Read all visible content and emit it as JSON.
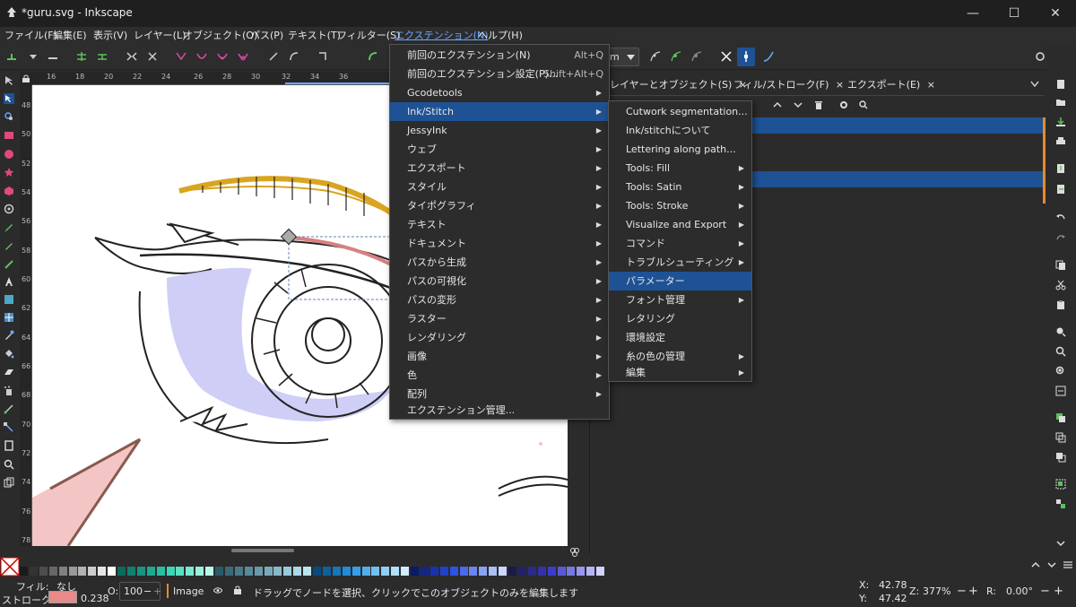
{
  "window": {
    "title": "*guru.svg - Inkscape",
    "controls": [
      "—",
      "☐",
      "✕"
    ]
  },
  "menubar": {
    "items": [
      "ファイル(F)",
      "編集(E)",
      "表示(V)",
      "レイヤー(L)",
      "オブジェクト(O)",
      "パス(P)",
      "テキスト(T)",
      "フィルター(S)",
      "エクステンション(N)",
      "ヘルプ(H)"
    ],
    "active_index": 8
  },
  "toolbar": {
    "units_label": "m"
  },
  "rulers": {
    "h_ticks": [
      "16",
      "18",
      "20",
      "22",
      "24",
      "26",
      "28",
      "30",
      "32",
      "34",
      "36"
    ],
    "v_ticks": [
      "48",
      "50",
      "52",
      "54",
      "56",
      "58",
      "60",
      "62",
      "64",
      "66",
      "68",
      "70",
      "72",
      "74",
      "76",
      "78"
    ]
  },
  "extensions_menu": {
    "items": [
      {
        "label": "前回のエクステンション(N)",
        "accel": "Alt+Q",
        "submenu": false
      },
      {
        "label": "前回のエクステンション設定(P)...",
        "accel": "Shift+Alt+Q",
        "submenu": false
      },
      {
        "label": "Gcodetools",
        "accel": "",
        "submenu": true
      },
      {
        "label": "Ink/Stitch",
        "accel": "",
        "submenu": true
      },
      {
        "label": "JessyInk",
        "accel": "",
        "submenu": true
      },
      {
        "label": "ウェブ",
        "accel": "",
        "submenu": true
      },
      {
        "label": "エクスポート",
        "accel": "",
        "submenu": true
      },
      {
        "label": "スタイル",
        "accel": "",
        "submenu": true
      },
      {
        "label": "タイポグラフィ",
        "accel": "",
        "submenu": true
      },
      {
        "label": "テキスト",
        "accel": "",
        "submenu": true
      },
      {
        "label": "ドキュメント",
        "accel": "",
        "submenu": true
      },
      {
        "label": "パスから生成",
        "accel": "",
        "submenu": true
      },
      {
        "label": "パスの可視化",
        "accel": "",
        "submenu": true
      },
      {
        "label": "パスの変形",
        "accel": "",
        "submenu": true
      },
      {
        "label": "ラスター",
        "accel": "",
        "submenu": true
      },
      {
        "label": "レンダリング",
        "accel": "",
        "submenu": true
      },
      {
        "label": "画像",
        "accel": "",
        "submenu": true
      },
      {
        "label": "色",
        "accel": "",
        "submenu": true
      },
      {
        "label": "配列",
        "accel": "",
        "submenu": true
      },
      {
        "label": "エクステンション管理...",
        "accel": "",
        "submenu": false
      }
    ],
    "highlighted_index": 3
  },
  "inkstitch_menu": {
    "items": [
      {
        "label": "Cutwork segmentation...",
        "submenu": false
      },
      {
        "label": "Ink/stitchについて",
        "submenu": false
      },
      {
        "label": "Lettering along path...",
        "submenu": false
      },
      {
        "label": "Tools: Fill",
        "submenu": true
      },
      {
        "label": "Tools: Satin",
        "submenu": true
      },
      {
        "label": "Tools: Stroke",
        "submenu": true
      },
      {
        "label": "Visualize and Export",
        "submenu": true
      },
      {
        "label": "コマンド",
        "submenu": true
      },
      {
        "label": "トラブルシューティング",
        "submenu": true
      },
      {
        "label": "パラメーター",
        "submenu": false
      },
      {
        "label": "フォント管理",
        "submenu": true
      },
      {
        "label": "レタリング",
        "submenu": false
      },
      {
        "label": "環境設定",
        "submenu": false
      },
      {
        "label": "糸の色の管理",
        "submenu": true
      },
      {
        "label": "編集",
        "submenu": true
      }
    ],
    "highlighted_index": 9
  },
  "panel": {
    "tabs": [
      "レイヤーとオブジェクト(S)",
      "フィル/ストローク(F)",
      "エクスポート(E)"
    ],
    "close_glyph": "×"
  },
  "status": {
    "fill_label": "フィル:",
    "fill_value": "なし",
    "stroke_label": "ストローク:",
    "stroke_width": "0.238",
    "opacity_label": "O:",
    "opacity_value": "100",
    "layer_name": "Image",
    "message": "ドラッグでノードを選択、クリックでこのオブジェクトのみを編集します",
    "x_label": "X:",
    "x_value": "42.78",
    "y_label": "Y:",
    "y_value": "47.42",
    "zoom_label": "Z:",
    "zoom_value": "377%",
    "rotate_label": "R:",
    "rotate_value": "0.00°",
    "minus": "−",
    "plus": "+"
  },
  "colors": {
    "accent": "#1e5294",
    "stroke_swatch": "#e88a8a",
    "eyebrow": "#d9a520",
    "iris_fill": "#c9c9f5"
  }
}
